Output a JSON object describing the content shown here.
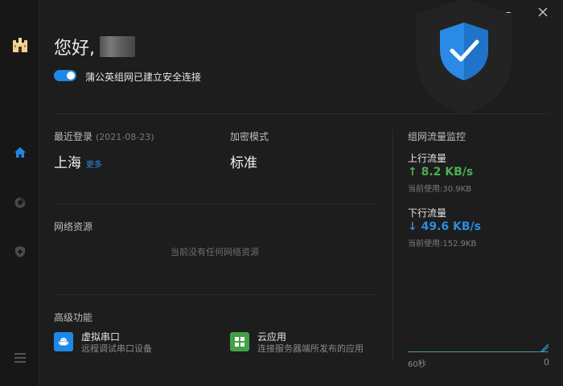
{
  "window": {
    "minimize_label": "minimize",
    "close_label": "close"
  },
  "sidebar": {
    "items": [
      {
        "name": "logo",
        "icon": "castle-logo-icon"
      },
      {
        "name": "home",
        "icon": "home-icon",
        "active": true
      },
      {
        "name": "network",
        "icon": "network-ring-icon"
      },
      {
        "name": "security",
        "icon": "shield-plus-icon"
      },
      {
        "name": "menu",
        "icon": "menu-icon"
      }
    ]
  },
  "header": {
    "greeting": "您好,",
    "connection_toggle_on": true,
    "connection_status": "蒲公英组网已建立安全连接"
  },
  "login": {
    "label": "最近登录",
    "date": "(2021-08-23)",
    "location": "上海",
    "more_link": "更多"
  },
  "encryption": {
    "label": "加密模式",
    "value": "标准"
  },
  "resources": {
    "label": "网络资源",
    "empty_text": "当前没有任何网络资源"
  },
  "advanced": {
    "label": "高级功能",
    "features": [
      {
        "title": "虚拟串口",
        "desc": "远程调试串口设备",
        "icon": "android-icon",
        "color": "#1e88e5"
      },
      {
        "title": "云应用",
        "desc": "连接服务器端所发布的应用",
        "icon": "grid-apps-icon",
        "color": "#43a047"
      }
    ]
  },
  "traffic": {
    "title": "组网流量监控",
    "upload": {
      "label": "上行流量",
      "arrow": "↑",
      "value": "8.2 KB/s",
      "usage": "当前使用:30.9KB",
      "color": "#4caf50"
    },
    "download": {
      "label": "下行流量",
      "arrow": "↓",
      "value": "49.6 KB/s",
      "usage": "当前使用:152.9KB",
      "color": "#2b8be0"
    },
    "graph": {
      "left_label": "60秒",
      "right_label": "0"
    }
  },
  "colors": {
    "accent": "#1e88e5",
    "green": "#4caf50",
    "background": "#1d1d1d"
  }
}
